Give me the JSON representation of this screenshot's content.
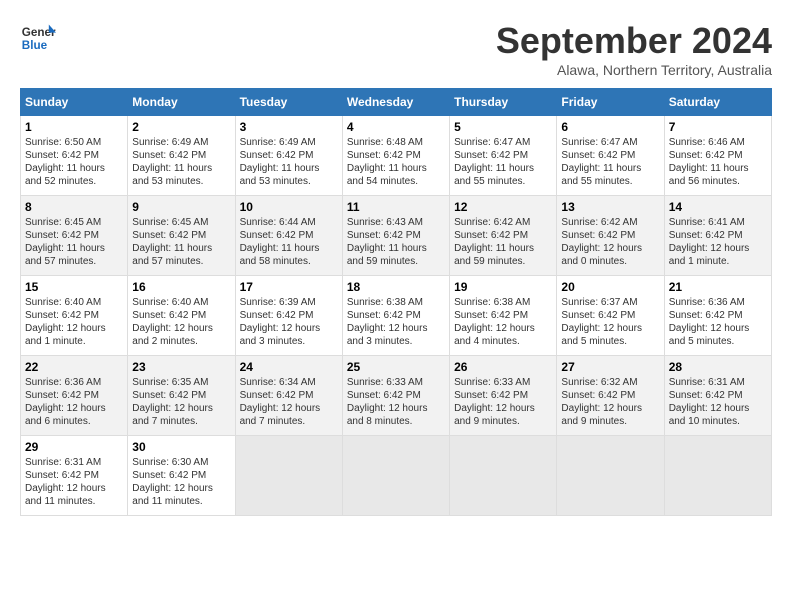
{
  "logo": {
    "line1": "General",
    "line2": "Blue"
  },
  "title": "September 2024",
  "subtitle": "Alawa, Northern Territory, Australia",
  "header": {
    "accent_color": "#2e75b6"
  },
  "days_of_week": [
    "Sunday",
    "Monday",
    "Tuesday",
    "Wednesday",
    "Thursday",
    "Friday",
    "Saturday"
  ],
  "weeks": [
    [
      {
        "day": 1,
        "content": "Sunrise: 6:50 AM\nSunset: 6:42 PM\nDaylight: 11 hours\nand 52 minutes."
      },
      {
        "day": 2,
        "content": "Sunrise: 6:49 AM\nSunset: 6:42 PM\nDaylight: 11 hours\nand 53 minutes."
      },
      {
        "day": 3,
        "content": "Sunrise: 6:49 AM\nSunset: 6:42 PM\nDaylight: 11 hours\nand 53 minutes."
      },
      {
        "day": 4,
        "content": "Sunrise: 6:48 AM\nSunset: 6:42 PM\nDaylight: 11 hours\nand 54 minutes."
      },
      {
        "day": 5,
        "content": "Sunrise: 6:47 AM\nSunset: 6:42 PM\nDaylight: 11 hours\nand 55 minutes."
      },
      {
        "day": 6,
        "content": "Sunrise: 6:47 AM\nSunset: 6:42 PM\nDaylight: 11 hours\nand 55 minutes."
      },
      {
        "day": 7,
        "content": "Sunrise: 6:46 AM\nSunset: 6:42 PM\nDaylight: 11 hours\nand 56 minutes."
      }
    ],
    [
      {
        "day": 8,
        "content": "Sunrise: 6:45 AM\nSunset: 6:42 PM\nDaylight: 11 hours\nand 57 minutes."
      },
      {
        "day": 9,
        "content": "Sunrise: 6:45 AM\nSunset: 6:42 PM\nDaylight: 11 hours\nand 57 minutes."
      },
      {
        "day": 10,
        "content": "Sunrise: 6:44 AM\nSunset: 6:42 PM\nDaylight: 11 hours\nand 58 minutes."
      },
      {
        "day": 11,
        "content": "Sunrise: 6:43 AM\nSunset: 6:42 PM\nDaylight: 11 hours\nand 59 minutes."
      },
      {
        "day": 12,
        "content": "Sunrise: 6:42 AM\nSunset: 6:42 PM\nDaylight: 11 hours\nand 59 minutes."
      },
      {
        "day": 13,
        "content": "Sunrise: 6:42 AM\nSunset: 6:42 PM\nDaylight: 12 hours\nand 0 minutes."
      },
      {
        "day": 14,
        "content": "Sunrise: 6:41 AM\nSunset: 6:42 PM\nDaylight: 12 hours\nand 1 minute."
      }
    ],
    [
      {
        "day": 15,
        "content": "Sunrise: 6:40 AM\nSunset: 6:42 PM\nDaylight: 12 hours\nand 1 minute."
      },
      {
        "day": 16,
        "content": "Sunrise: 6:40 AM\nSunset: 6:42 PM\nDaylight: 12 hours\nand 2 minutes."
      },
      {
        "day": 17,
        "content": "Sunrise: 6:39 AM\nSunset: 6:42 PM\nDaylight: 12 hours\nand 3 minutes."
      },
      {
        "day": 18,
        "content": "Sunrise: 6:38 AM\nSunset: 6:42 PM\nDaylight: 12 hours\nand 3 minutes."
      },
      {
        "day": 19,
        "content": "Sunrise: 6:38 AM\nSunset: 6:42 PM\nDaylight: 12 hours\nand 4 minutes."
      },
      {
        "day": 20,
        "content": "Sunrise: 6:37 AM\nSunset: 6:42 PM\nDaylight: 12 hours\nand 5 minutes."
      },
      {
        "day": 21,
        "content": "Sunrise: 6:36 AM\nSunset: 6:42 PM\nDaylight: 12 hours\nand 5 minutes."
      }
    ],
    [
      {
        "day": 22,
        "content": "Sunrise: 6:36 AM\nSunset: 6:42 PM\nDaylight: 12 hours\nand 6 minutes."
      },
      {
        "day": 23,
        "content": "Sunrise: 6:35 AM\nSunset: 6:42 PM\nDaylight: 12 hours\nand 7 minutes."
      },
      {
        "day": 24,
        "content": "Sunrise: 6:34 AM\nSunset: 6:42 PM\nDaylight: 12 hours\nand 7 minutes."
      },
      {
        "day": 25,
        "content": "Sunrise: 6:33 AM\nSunset: 6:42 PM\nDaylight: 12 hours\nand 8 minutes."
      },
      {
        "day": 26,
        "content": "Sunrise: 6:33 AM\nSunset: 6:42 PM\nDaylight: 12 hours\nand 9 minutes."
      },
      {
        "day": 27,
        "content": "Sunrise: 6:32 AM\nSunset: 6:42 PM\nDaylight: 12 hours\nand 9 minutes."
      },
      {
        "day": 28,
        "content": "Sunrise: 6:31 AM\nSunset: 6:42 PM\nDaylight: 12 hours\nand 10 minutes."
      }
    ],
    [
      {
        "day": 29,
        "content": "Sunrise: 6:31 AM\nSunset: 6:42 PM\nDaylight: 12 hours\nand 11 minutes."
      },
      {
        "day": 30,
        "content": "Sunrise: 6:30 AM\nSunset: 6:42 PM\nDaylight: 12 hours\nand 11 minutes."
      },
      null,
      null,
      null,
      null,
      null
    ]
  ]
}
